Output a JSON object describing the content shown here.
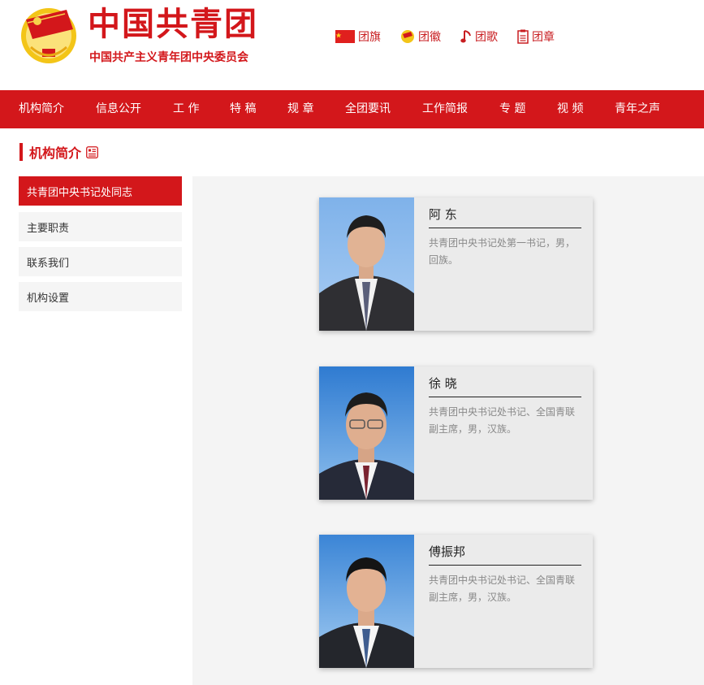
{
  "header": {
    "title": "中国共青团",
    "subtitle": "中国共产主义青年团中央委员会",
    "links": [
      {
        "label": "团旗",
        "icon": "flag-icon"
      },
      {
        "label": "团徽",
        "icon": "emblem-icon"
      },
      {
        "label": "团歌",
        "icon": "music-note-icon"
      },
      {
        "label": "团章",
        "icon": "document-icon"
      }
    ]
  },
  "nav": {
    "items": [
      "机构简介",
      "信息公开",
      "工 作",
      "特 稿",
      "规 章",
      "全团要讯",
      "工作简报",
      "专 题",
      "视 频",
      "青年之声"
    ]
  },
  "section": {
    "title": "机构简介"
  },
  "sidebar": {
    "items": [
      {
        "label": "共青团中央书记处同志",
        "active": true
      },
      {
        "label": "主要职责",
        "active": false
      },
      {
        "label": "联系我们",
        "active": false
      },
      {
        "label": "机构设置",
        "active": false
      }
    ]
  },
  "cards": [
    {
      "name": "阿 东",
      "desc": "共青团中央书记处第一书记，男，回族。"
    },
    {
      "name": "徐 晓",
      "desc": "共青团中央书记处书记、全国青联副主席，男，汉族。"
    },
    {
      "name": "傅振邦",
      "desc": "共青团中央书记处书记、全国青联副主席，男，汉族。"
    }
  ],
  "colors": {
    "brand_red": "#d3171b",
    "card_bg": "#ebebeb",
    "panel_bg": "#f4f4f4"
  }
}
